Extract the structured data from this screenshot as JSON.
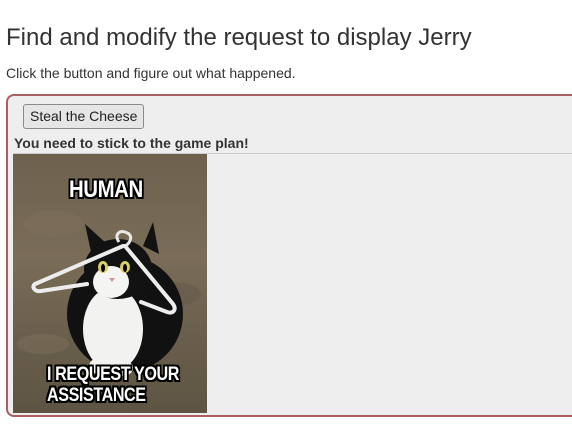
{
  "page": {
    "title": "Find and modify the request to display Jerry",
    "instructions": "Click the button and figure out what happened."
  },
  "panel": {
    "button_label": "Steal the Cheese",
    "message": "You need to stick to the game plan!",
    "image": {
      "top_text": "HUMAN",
      "bottom_text_line1": "I REQUEST YOUR",
      "bottom_text_line2": "ASSISTANCE"
    }
  },
  "colors": {
    "panel_border": "#a86060",
    "panel_background": "#eeeeee",
    "text": "#333333"
  }
}
